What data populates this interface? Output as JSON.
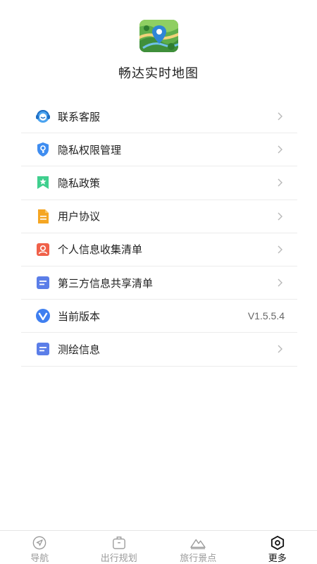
{
  "app": {
    "name": "畅达实时地图"
  },
  "menu": [
    {
      "label": "联系客服",
      "icon": "customer-service-icon"
    },
    {
      "label": "隐私权限管理",
      "icon": "shield-key-icon"
    },
    {
      "label": "隐私政策",
      "icon": "bookmark-star-icon"
    },
    {
      "label": "用户协议",
      "icon": "document-icon"
    },
    {
      "label": "个人信息收集清单",
      "icon": "person-card-icon"
    },
    {
      "label": "第三方信息共享清单",
      "icon": "list-doc-icon"
    },
    {
      "label": "当前版本",
      "icon": "version-v-icon",
      "value": "V1.5.5.4"
    },
    {
      "label": "测绘信息",
      "icon": "list-doc-icon"
    }
  ],
  "tabs": [
    {
      "label": "导航",
      "icon": "navigation-icon",
      "active": false
    },
    {
      "label": "出行规划",
      "icon": "luggage-icon",
      "active": false
    },
    {
      "label": "旅行景点",
      "icon": "mountain-icon",
      "active": false
    },
    {
      "label": "更多",
      "icon": "hexagon-settings-icon",
      "active": true
    }
  ],
  "colors": {
    "accent": "#4a8cf0",
    "active_tab": "#111111",
    "inactive_tab": "#9a9a9a"
  }
}
